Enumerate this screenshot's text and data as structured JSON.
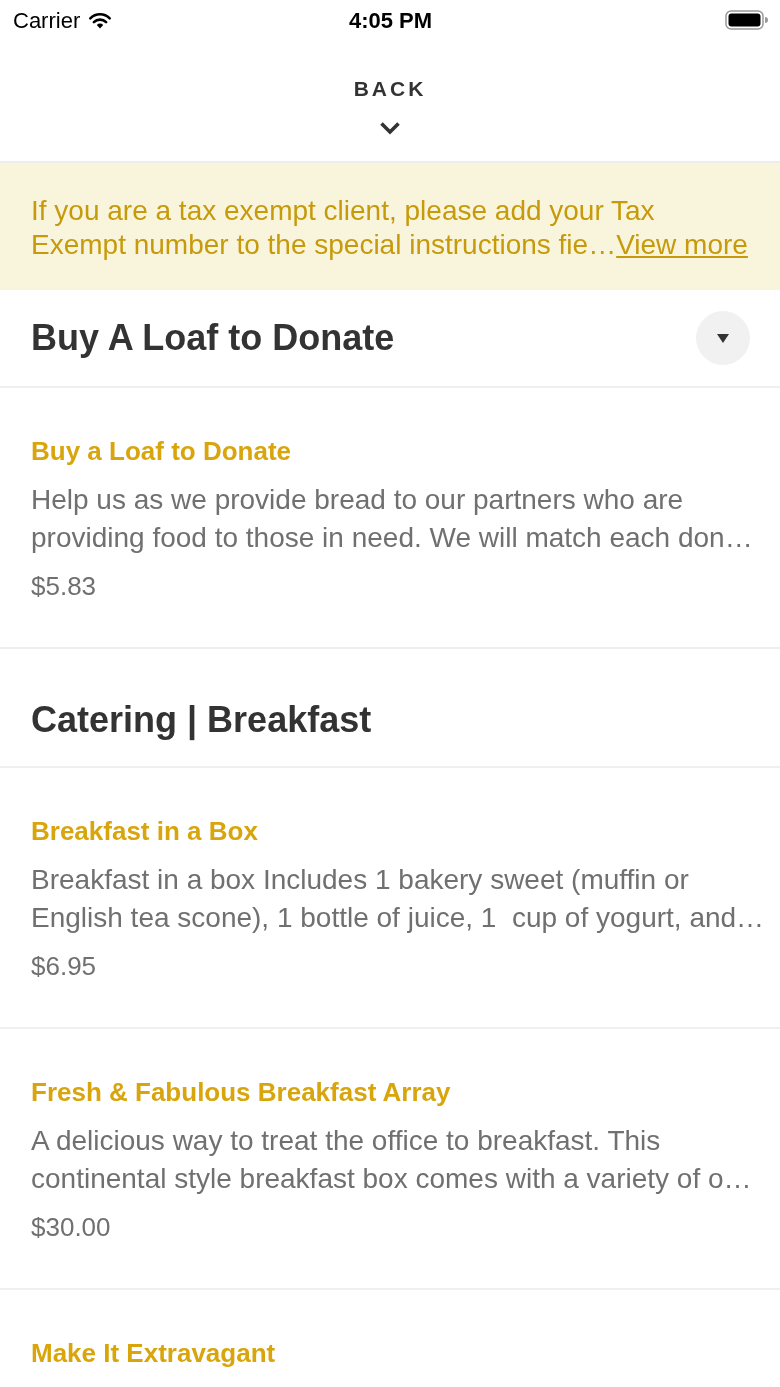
{
  "status_bar": {
    "carrier": "Carrier",
    "time": "4:05 PM"
  },
  "header": {
    "back_label": "BACK"
  },
  "notice": {
    "text": "If you are a tax exempt client, please add your Tax Exempt number to the special instructions fie…",
    "link": "View more"
  },
  "sections": [
    {
      "title": "Buy A Loaf to Donate",
      "collapse_button": true,
      "items": [
        {
          "name": "Buy a Loaf to Donate",
          "description": "Help us as we provide bread to our partners who are providing food to those in need. We will match each don…",
          "price": "$5.83"
        }
      ]
    },
    {
      "title": "Catering | Breakfast",
      "collapse_button": false,
      "items": [
        {
          "name": "Breakfast in a Box",
          "description": "Breakfast in a box Includes 1 bakery sweet (muffin or English tea scone), 1 bottle of juice, 1  cup of yogurt, and…",
          "price": "$6.95"
        },
        {
          "name": "Fresh & Fabulous Breakfast Array",
          "description": "A delicious way to treat the office to breakfast. This continental style breakfast box comes with a variety of o…",
          "price": "$30.00"
        },
        {
          "name": "Make It Extravagant"
        }
      ]
    }
  ]
}
